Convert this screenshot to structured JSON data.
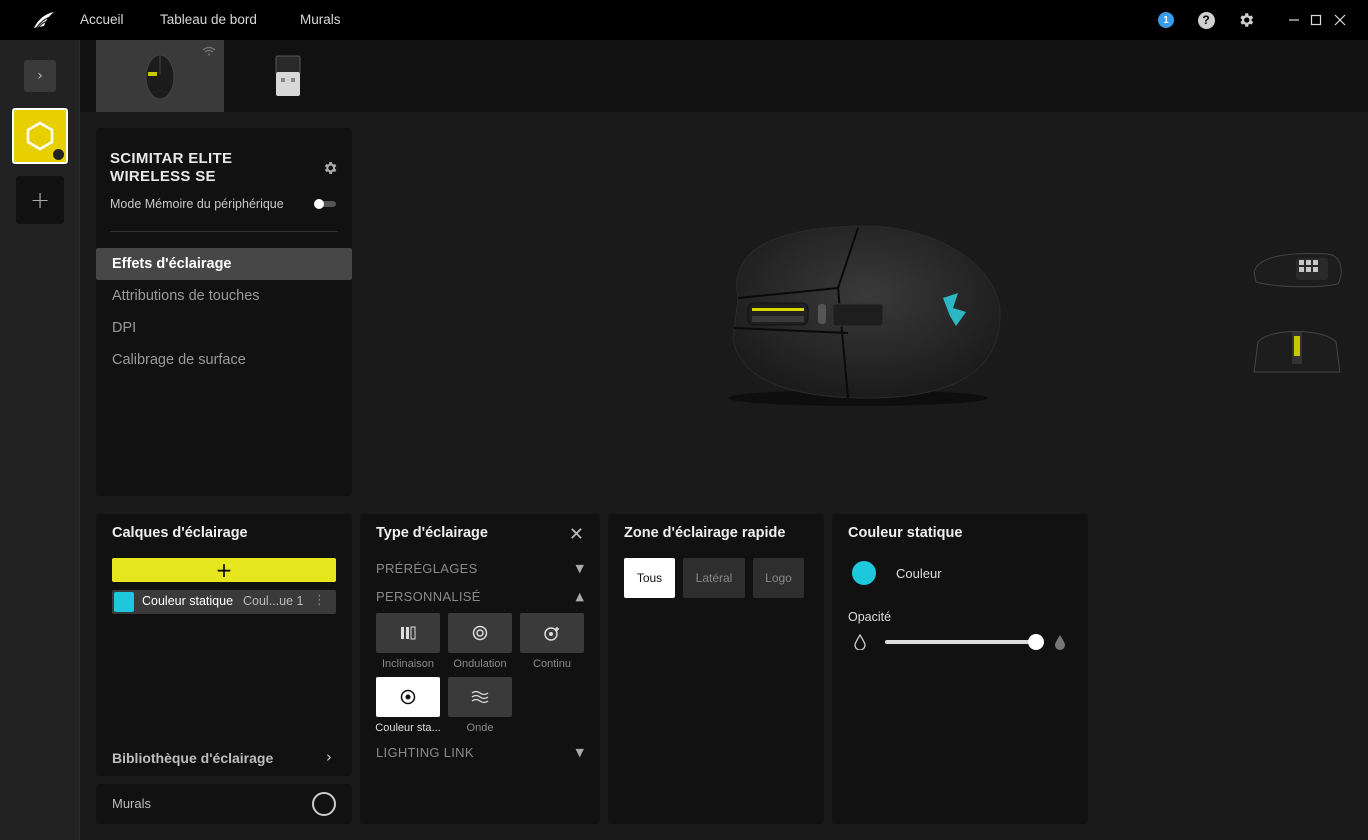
{
  "nav": {
    "home": "Accueil",
    "dashboard": "Tableau de bord",
    "murals": "Murals"
  },
  "titlebar": {
    "notification_count": "1",
    "help_glyph": "?",
    "icons": [
      "notification-badge",
      "help-icon",
      "gear-icon",
      "minimize-icon",
      "maximize-icon",
      "close-icon"
    ]
  },
  "devices": [
    {
      "name": "mouse-device",
      "active": true,
      "wireless": true
    },
    {
      "name": "dongle-device",
      "active": false
    }
  ],
  "device": {
    "name_line1": "SCIMITAR ELITE",
    "name_line2": "WIRELESS SE",
    "memory_mode_label": "Mode Mémoire du périphérique",
    "memory_mode_on": false
  },
  "menu": [
    {
      "label": "Effets d'éclairage",
      "active": true
    },
    {
      "label": "Attributions de touches",
      "active": false
    },
    {
      "label": "DPI",
      "active": false
    },
    {
      "label": "Calibrage de surface",
      "active": false
    }
  ],
  "layers": {
    "title": "Calques d'éclairage",
    "add_symbol": "+",
    "items": [
      {
        "name": "Couleur statique",
        "sub": "Coul...ue 1",
        "color": "#1ec8dc"
      }
    ],
    "library_label": "Bibliothèque d'éclairage"
  },
  "murals_panel": {
    "label": "Murals"
  },
  "lighting_type": {
    "title": "Type d'éclairage",
    "presets_label": "PRÉRÉGLAGES",
    "custom_label": "PERSONNALISÉ",
    "link_label": "LIGHTING LINK",
    "types": [
      {
        "label": "Inclinaison",
        "icon": "tilt-icon",
        "active": false
      },
      {
        "label": "Ondulation",
        "icon": "ripple-icon",
        "active": false
      },
      {
        "label": "Continu",
        "icon": "continuous-icon",
        "active": false
      },
      {
        "label": "Couleur sta...",
        "icon": "static-color-icon",
        "active": true
      },
      {
        "label": "Onde",
        "icon": "wave-icon",
        "active": false
      }
    ]
  },
  "quick_zone": {
    "title": "Zone d'éclairage rapide",
    "zones": [
      {
        "label": "Tous",
        "active": true
      },
      {
        "label": "Latéral",
        "active": false
      },
      {
        "label": "Logo",
        "active": false
      }
    ]
  },
  "static_color": {
    "title": "Couleur statique",
    "color_label": "Couleur",
    "color": "#1ec8dc",
    "opacity_label": "Opacité",
    "opacity_value": 1.0
  },
  "colors": {
    "accent_yellow": "#e6e61e",
    "profile_yellow": "#e8d000",
    "cyan": "#1ec8dc",
    "badge_blue": "#3a9be8"
  }
}
